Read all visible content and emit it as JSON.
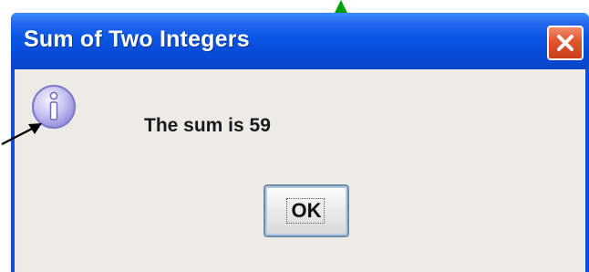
{
  "dialog": {
    "title": "Sum of Two Integers",
    "message": "The sum is 59",
    "ok_label": "OK",
    "icon": "information-icon",
    "close_icon": "close-icon"
  },
  "annotations": {
    "black_arrow": "pointer-arrow",
    "green_arrow": "pointer-arrow",
    "green_color": "#00a000"
  },
  "colors": {
    "titlebar": "#0a55e4",
    "close_button": "#e0552e",
    "client_background": "#ecebe6"
  }
}
